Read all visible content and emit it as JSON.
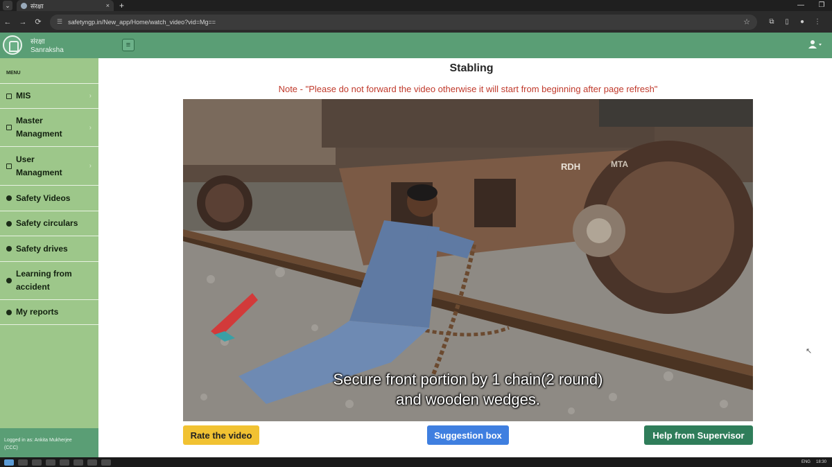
{
  "browser": {
    "tab_title": "संरक्षा",
    "tab_close": "×",
    "new_tab": "+",
    "url": "safetyngp.in/New_app/Home/watch_video?vid=Mg==",
    "nav": {
      "back": "←",
      "forward": "→",
      "reload": "⟳"
    },
    "star": "☆",
    "window_controls": [
      "—",
      "❐"
    ]
  },
  "header": {
    "brand_hindi": "संरक्षा",
    "brand": "Sanraksha",
    "menu_toggle": "≡",
    "user_icon": "user-icon",
    "user_caret": "▾"
  },
  "sidebar": {
    "menu_label": "MENU",
    "items": [
      {
        "label": "MIS",
        "icon": "square-icon"
      },
      {
        "label": "Master\nManagment",
        "icon": "square-icon"
      },
      {
        "label": "User\nManagment",
        "icon": "square-icon"
      },
      {
        "label": "Safety Videos",
        "icon": "dot-icon"
      },
      {
        "label": "Safety circulars",
        "icon": "dot-icon"
      },
      {
        "label": "Safety drives",
        "icon": "dot-icon"
      },
      {
        "label": "Learning from\naccident",
        "icon": "dot-icon"
      },
      {
        "label": "My reports",
        "icon": "dot-icon"
      }
    ],
    "logged_in": "Logged in as: Ankita Mukherjee\n(CCC)"
  },
  "main": {
    "title": "Stabling",
    "note": "Note - \"Please do not forward the video otherwise it will start from beginning after page refresh\"",
    "video": {
      "caption_line1": "Secure front portion by 1 chain(2 round)",
      "caption_line2": "and wooden wedges.",
      "stencil_1": "RDH",
      "stencil_2": "MTA"
    },
    "buttons": {
      "rate": "Rate the video",
      "suggestion": "Suggestion box",
      "help": "Help from Supervisor"
    }
  },
  "taskbar": {
    "lang": "ENG",
    "time": "18:30"
  },
  "colors": {
    "header_green": "#5a9e75",
    "sidebar_green": "#9dc78a",
    "note_red": "#c0392b",
    "rate_yellow": "#f1c232",
    "suggestion_blue": "#3f7fe0",
    "help_green": "#2f7d5a"
  }
}
